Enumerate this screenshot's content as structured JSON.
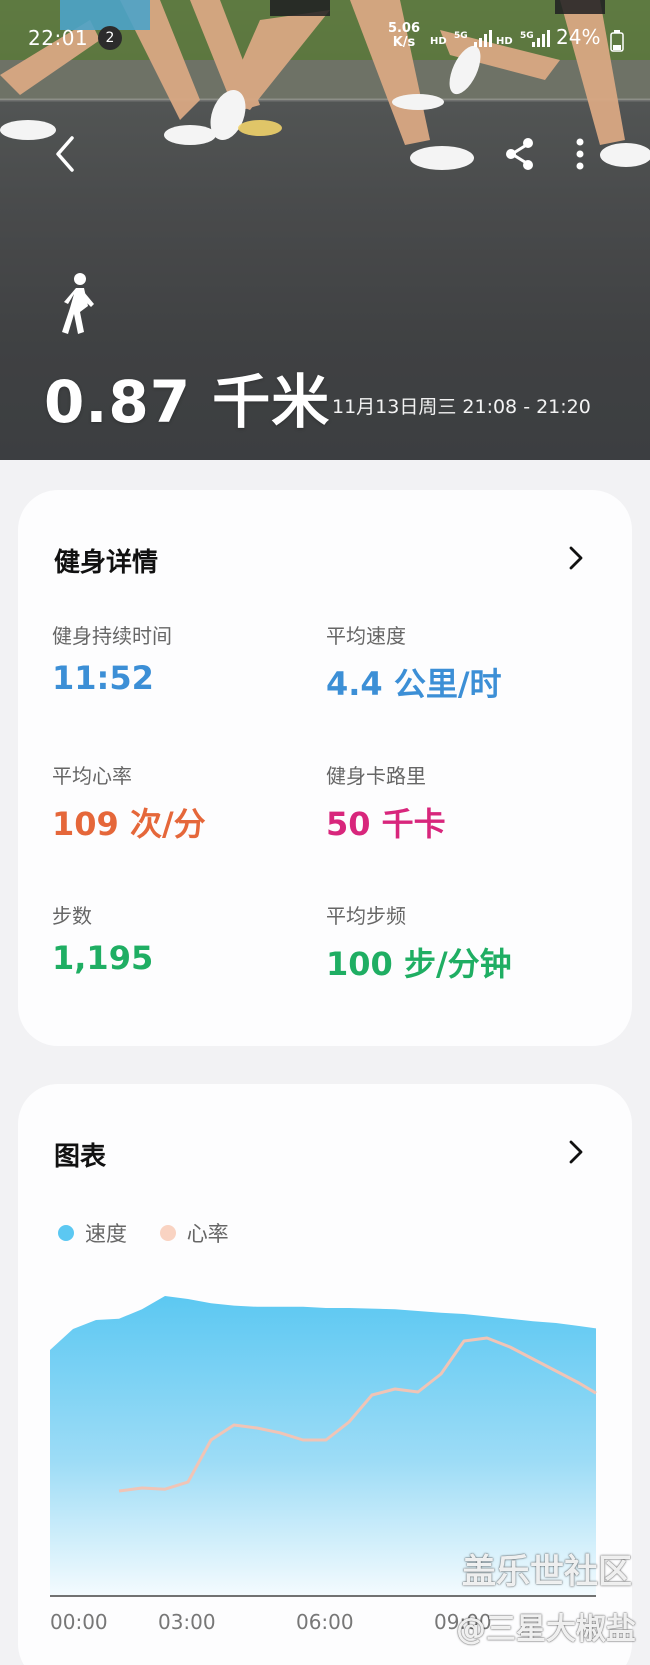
{
  "status_bar": {
    "time": "22:01",
    "notification_count": "2",
    "net_speed_value": "5.06",
    "net_speed_unit": "K/s",
    "battery": "24%"
  },
  "hero": {
    "distance": "0.87 千米",
    "date_range": "11月13日周三 21:08 - 21:20"
  },
  "details": {
    "title": "健身详情",
    "metrics": [
      {
        "label": "健身持续时间",
        "value": "11:52",
        "color": "#3c8fd6"
      },
      {
        "label": "平均速度",
        "value": "4.4 公里/时",
        "color": "#3c8fd6"
      },
      {
        "label": "平均心率",
        "value": "109 次/分",
        "color": "#e5673a"
      },
      {
        "label": "健身卡路里",
        "value": "50 千卡",
        "color": "#d8267c"
      },
      {
        "label": "步数",
        "value": "1,195",
        "color": "#1fae63"
      },
      {
        "label": "平均步频",
        "value": "100 步/分钟",
        "color": "#1fae63"
      }
    ]
  },
  "chart": {
    "title": "图表",
    "legend": [
      {
        "label": "速度",
        "color": "#5cc8f2"
      },
      {
        "label": "心率",
        "color": "#f9d3c2"
      }
    ]
  },
  "chart_data": {
    "type": "area",
    "x_ticks": [
      "00:00",
      "03:00",
      "06:00",
      "09:00"
    ],
    "series": [
      {
        "name": "速度",
        "style": "area",
        "color": "#5cc8f2",
        "x": [
          0,
          0.5,
          1,
          1.5,
          2,
          2.5,
          3,
          3.5,
          4,
          4.5,
          5,
          5.5,
          6,
          6.5,
          7,
          7.5,
          8,
          8.5,
          9,
          9.5,
          10,
          10.5,
          11,
          11.5,
          11.87
        ],
        "values": [
          4.1,
          4.45,
          4.6,
          4.62,
          4.78,
          5.0,
          4.95,
          4.88,
          4.84,
          4.82,
          4.82,
          4.82,
          4.8,
          4.8,
          4.79,
          4.78,
          4.75,
          4.72,
          4.7,
          4.66,
          4.62,
          4.58,
          4.55,
          4.5,
          4.46
        ]
      },
      {
        "name": "心率",
        "style": "line",
        "color": "#f0c4b6",
        "x": [
          1.5,
          2,
          2.5,
          3,
          3.5,
          4,
          4.5,
          5,
          5.5,
          6,
          6.5,
          7,
          7.5,
          8,
          8.5,
          9,
          9.5,
          10,
          10.5,
          11,
          11.5,
          11.87
        ],
        "values": [
          1.75,
          1.8,
          1.78,
          1.9,
          2.6,
          2.85,
          2.8,
          2.72,
          2.6,
          2.6,
          2.9,
          3.35,
          3.45,
          3.4,
          3.7,
          4.25,
          4.3,
          4.15,
          3.95,
          3.75,
          3.55,
          3.38
        ]
      }
    ],
    "grid": false,
    "legend_position": "top-left"
  },
  "watermark": {
    "line1": "盖乐世社区",
    "line2": "@三星大椒盐"
  }
}
